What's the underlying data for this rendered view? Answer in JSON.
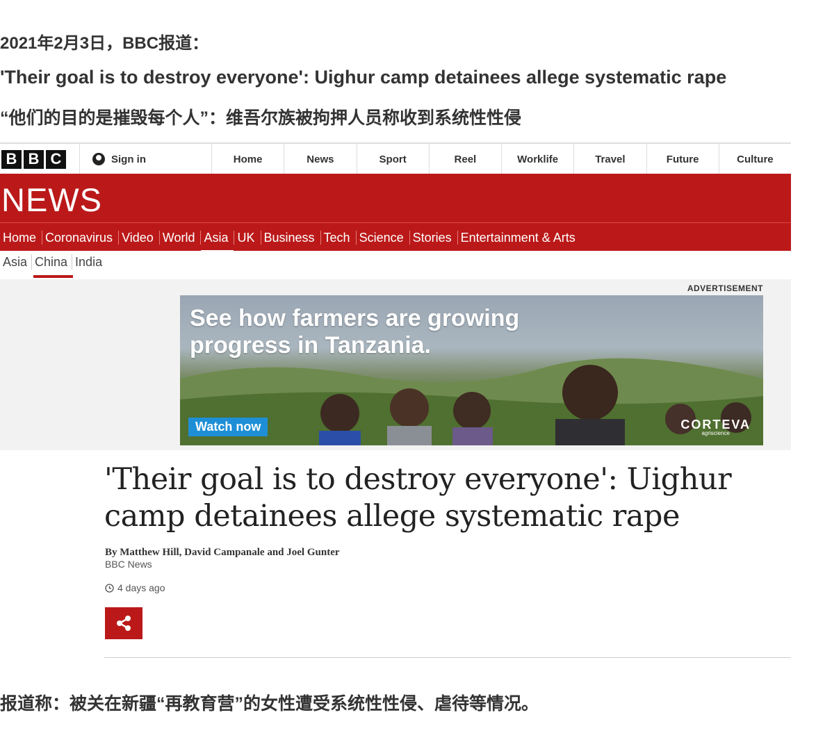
{
  "intro": {
    "date_line": "2021年2月3日，BBC报道：",
    "english_title": "'Their goal is to destroy everyone': Uighur camp detainees allege systematic rape",
    "chinese_title": "“他们的目的是摧毁每个人”：维吾尔族被拘押人员称收到系统性性侵"
  },
  "bbc_bar": {
    "logo_letters": [
      "B",
      "B",
      "C"
    ],
    "sign_in": "Sign in",
    "nav": [
      "Home",
      "News",
      "Sport",
      "Reel",
      "Worklife",
      "Travel",
      "Future",
      "Culture"
    ]
  },
  "news": {
    "wordmark": "NEWS",
    "nav": [
      "Home",
      "Coronavirus",
      "Video",
      "World",
      "Asia",
      "UK",
      "Business",
      "Tech",
      "Science",
      "Stories",
      "Entertainment & Arts"
    ],
    "active_nav": "Asia",
    "subnav": [
      "Asia",
      "China",
      "India"
    ],
    "active_subnav": "China"
  },
  "ad": {
    "label": "ADVERTISEMENT",
    "line1": "See how farmers are growing",
    "line2": "progress in Tanzania.",
    "cta": "Watch now",
    "brand": "CORTEVA",
    "brand_sub": "agriscience"
  },
  "article": {
    "headline": "'Their goal is to destroy everyone': Uighur camp detainees allege systematic rape",
    "byline": "By Matthew Hill, David Campanale and Joel Gunter",
    "org": "BBC News",
    "timestamp": "4 days ago"
  },
  "outro": "报道称：被关在新疆“再教育营”的女性遭受系统性性侵、虐待等情况。",
  "colors": {
    "bbc_red": "#bb1919",
    "ad_blue": "#1e8fd6"
  }
}
